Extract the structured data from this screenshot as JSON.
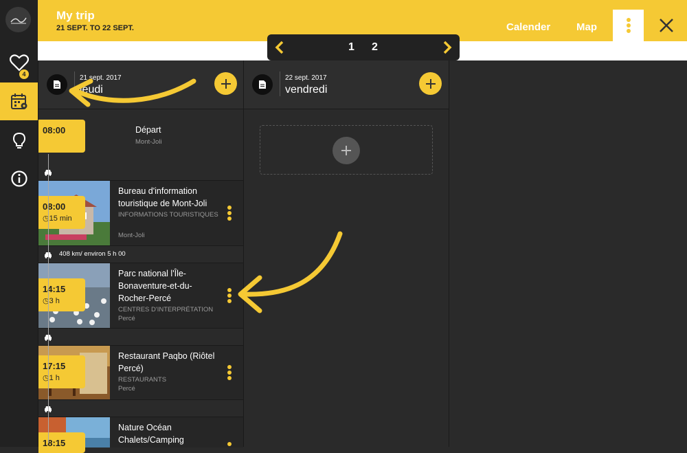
{
  "header": {
    "title": "My trip",
    "dates": "21 SEPT. TO 22 SEPT.",
    "calendar_label": "Calender",
    "map_label": "Map"
  },
  "sidebar": {
    "favorites_count": "4"
  },
  "pager": {
    "page1": "1",
    "page2": "2"
  },
  "days": [
    {
      "date": "21 sept. 2017",
      "name": "jeudi"
    },
    {
      "date": "22 sept. 2017",
      "name": "vendredi"
    }
  ],
  "start": {
    "time": "08:00",
    "title": "Départ",
    "location": "Mont-Joli"
  },
  "items": [
    {
      "time": "08:00",
      "duration": "15 min",
      "title": "Bureau d'information touristique de Mont-Joli",
      "category": "INFORMATIONS TOURISTIQUES",
      "location": "Mont-Joli"
    },
    {
      "time": "14:15",
      "duration": "3 h",
      "title": "Parc national l'Île-Bonaventure-et-du-Rocher-Percé",
      "category": "CENTRES D'INTERPRÉTATION",
      "location": "Percé"
    },
    {
      "time": "17:15",
      "duration": "1 h",
      "title": "Restaurant Paqbo (Riôtel Percé)",
      "category": "RESTAURANTS",
      "location": "Percé"
    },
    {
      "time": "18:15",
      "duration": "",
      "title": "Nature Océan Chalets/Camping",
      "category": "",
      "location": ""
    }
  ],
  "travel": [
    {
      "text": ""
    },
    {
      "text": "408 km/ environ 5 h 00"
    },
    {
      "text": ""
    },
    {
      "text": ""
    }
  ],
  "colors": {
    "accent": "#f5c934",
    "panel": "#2a2a2a",
    "sidebar": "#222222"
  },
  "icons": [
    "logo-icon",
    "heart-icon",
    "calendar-map-icon",
    "bulb-icon",
    "info-icon",
    "document-icon",
    "plus-icon",
    "car-icon",
    "clock-icon",
    "more-vertical-icon",
    "close-icon",
    "chevron-left-icon",
    "chevron-right-icon"
  ]
}
